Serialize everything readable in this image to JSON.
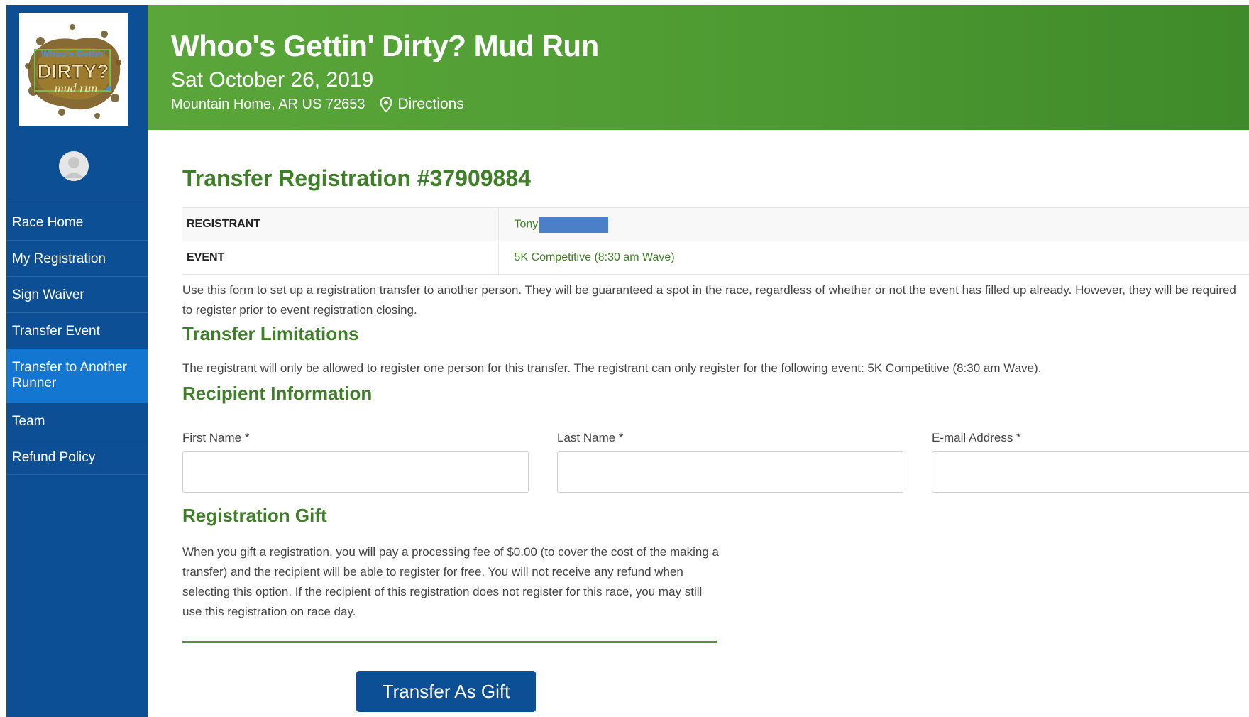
{
  "event": {
    "title": "Whoo's Gettin' Dirty? Mud Run",
    "date": "Sat October 26, 2019",
    "location": "Mountain Home, AR US 72653",
    "directions_label": "Directions"
  },
  "logo": {
    "line1": "Whoo's Gettin'",
    "line2": "DIRTY?",
    "line3": "mud run"
  },
  "sidebar": {
    "items": [
      {
        "label": "Race Home"
      },
      {
        "label": "My Registration"
      },
      {
        "label": "Sign Waiver"
      },
      {
        "label": "Transfer Event"
      },
      {
        "label": "Transfer to Another Runner"
      },
      {
        "label": "Team"
      },
      {
        "label": "Refund Policy"
      }
    ],
    "active_index": 4
  },
  "page": {
    "title": "Transfer Registration #37909884",
    "registrant_label": "REGISTRANT",
    "registrant_value": "Tony",
    "event_label": "EVENT",
    "event_value": "5K Competitive (8:30 am Wave)",
    "intro": "Use this form to set up a registration transfer to another person. They will be guaranteed a spot in the race, regardless of whether or not the event has filled up already. However, they will be required to register prior to event registration closing.",
    "limitations_title": "Transfer Limitations",
    "limitations_text": "The registrant will only be allowed to register one person for this transfer. The registrant can only register for the following event: ",
    "limitations_link": "5K Competitive (8:30 am Wave)",
    "limitations_end": ".",
    "recipient_title": "Recipient Information",
    "first_name_label": "First Name *",
    "first_name_value": "",
    "last_name_label": "Last Name *",
    "last_name_value": "",
    "email_label": "E-mail Address *",
    "email_value": "",
    "gift_title": "Registration Gift",
    "gift_text": "When you gift a registration, you will pay a processing fee of $0.00 (to cover the cost of the making a transfer) and the recipient will be able to register for free. You will not receive any refund when selecting this option. If the recipient of this registration does not register for this race, you may still use this registration on race day.",
    "gift_button": "Transfer As Gift"
  },
  "colors": {
    "sidebar": "#0d4f94",
    "sidebar_active": "#1376d1",
    "header_green": "#4f9c33",
    "title_green": "#3f7f28",
    "button": "#0d4f94"
  }
}
